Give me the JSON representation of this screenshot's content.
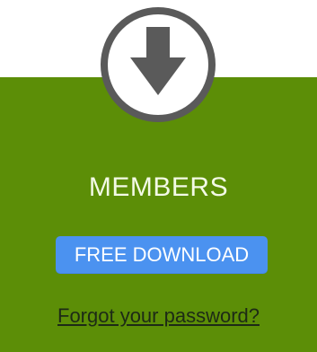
{
  "header": {
    "icon": "download-arrow-icon"
  },
  "card": {
    "title": "MEMBERS",
    "download_label": "FREE DOWNLOAD",
    "forgot_label": "Forgot your password?"
  },
  "colors": {
    "panel": "#5c8e07",
    "button": "#4b92f0",
    "badge_ring": "#5a5a5a",
    "title_text": "#f3fae6",
    "link_text": "#1d2a16"
  }
}
